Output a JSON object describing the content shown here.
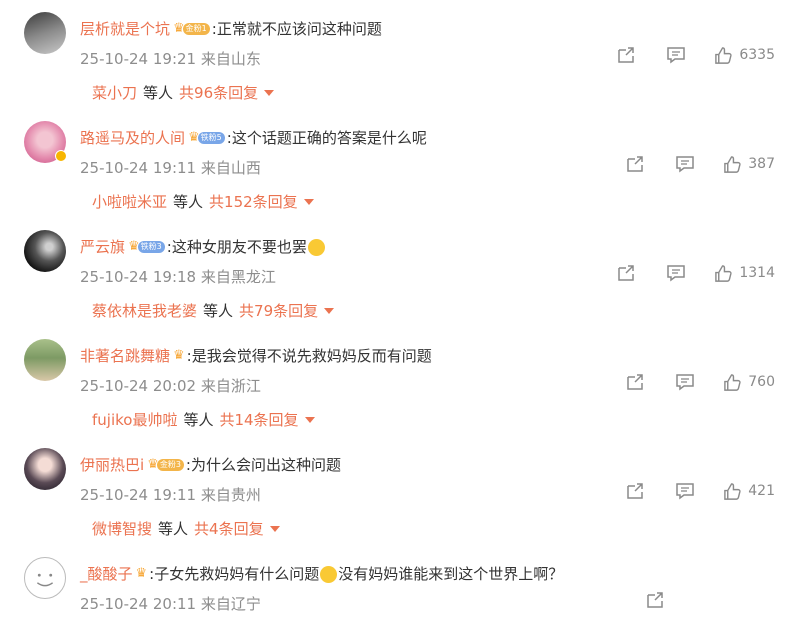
{
  "comments": [
    {
      "username": "层析就是个坑",
      "badge": "金粉1",
      "badge_color": "#f3b54a",
      "colon": ":",
      "text": "正常就不应该问这种问题",
      "time": "25-10-24 19:21",
      "location": "来自山东",
      "likes": "6335",
      "reply_name": "菜小刀",
      "reply_deng": "等人",
      "reply_count": "共96条回复"
    },
    {
      "username": "路遥马及的人间",
      "badge": "铁粉5",
      "badge_color": "#79a6e8",
      "colon": ":",
      "text": "这个话题正确的答案是什么呢",
      "time": "25-10-24 19:11",
      "location": "来自山西",
      "likes": "387",
      "reply_name": "小啦啦米亚",
      "reply_deng": "等人",
      "reply_count": "共152条回复"
    },
    {
      "username": "严云旗",
      "badge": "铁粉3",
      "badge_color": "#79a6e8",
      "colon": ":",
      "text": "这种女朋友不要也罢",
      "emoji_after": "smile-emoji",
      "time": "25-10-24 19:18",
      "location": "来自黑龙江",
      "likes": "1314",
      "reply_name": "蔡依林是我老婆",
      "reply_deng": "等人",
      "reply_count": "共79条回复"
    },
    {
      "username": "非著名跳舞糖",
      "badge": "",
      "colon": ":",
      "text": "是我会觉得不说先救妈妈反而有问题",
      "time": "25-10-24 20:02",
      "location": "来自浙江",
      "likes": "760",
      "reply_name": "fujiko最帅啦",
      "reply_deng": "等人",
      "reply_count": "共14条回复"
    },
    {
      "username": "伊丽热巴i",
      "badge": "金粉3",
      "badge_color": "#f3b54a",
      "colon": ":",
      "text": "为什么会问出这种问题",
      "time": "25-10-24 19:11",
      "location": "来自贵州",
      "likes": "421",
      "reply_name": "微博智搜",
      "reply_deng": "等人",
      "reply_count": "共4条回复"
    },
    {
      "username": "_酸酸子",
      "badge": "",
      "colon": ":",
      "text": "子女先救妈妈有什么问题",
      "emoji_mid": "cry-emoji",
      "text2": "没有妈妈谁能来到这个世界上啊？",
      "time": "25-10-24 20:11",
      "location": "来自辽宁",
      "likes": ""
    }
  ],
  "colors": {
    "accent": "#eb7350",
    "meta": "#8d8d8d",
    "icon": "#8a8a8a"
  },
  "icons": {
    "repost": "repost-icon",
    "comment": "comment-icon",
    "like": "like-icon",
    "caret": "caret-down-icon"
  }
}
